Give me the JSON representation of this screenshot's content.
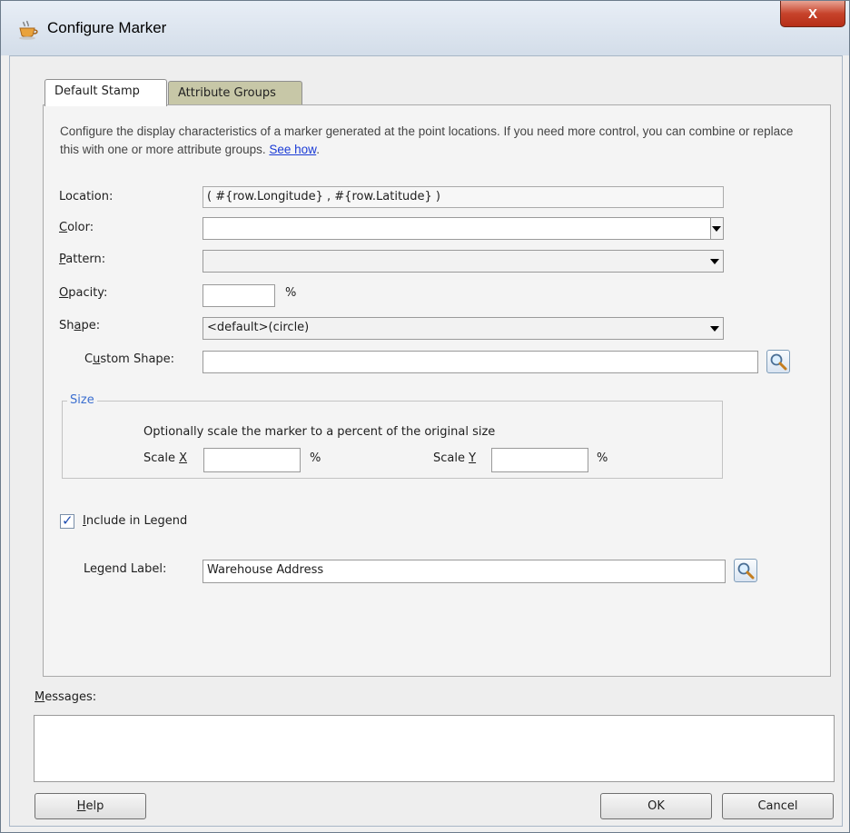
{
  "window": {
    "title": "Configure Marker",
    "close_label": "X"
  },
  "tabs": [
    {
      "label": "Default Stamp",
      "active": true
    },
    {
      "label": "Attribute Groups",
      "active": false
    }
  ],
  "description": {
    "text": "Configure the display characteristics of a marker generated at the point locations. If you need more control, you can combine or replace this with one or more attribute groups.",
    "link": "See how",
    "suffix": "."
  },
  "form": {
    "location": {
      "label": "Location:",
      "value": "( #{row.Longitude} , #{row.Latitude} )"
    },
    "color": {
      "label_mnemonic": "C",
      "label_rest": "olor:",
      "value": ""
    },
    "pattern": {
      "label_mnemonic": "P",
      "label_rest": "attern:",
      "value": ""
    },
    "opacity": {
      "label_mnemonic": "O",
      "label_rest": "pacity:",
      "value": "",
      "unit": "%"
    },
    "shape": {
      "label_pre": "Sh",
      "label_mnemonic": "a",
      "label_rest": "pe:",
      "value": "<default>(circle)"
    },
    "custom_shape": {
      "label_pre": "C",
      "label_mnemonic": "u",
      "label_rest": "stom Shape:",
      "value": ""
    }
  },
  "size": {
    "legend": "Size",
    "hint": "Optionally scale the marker to a percent of the original size",
    "scale_x": {
      "label_pre": "Scale ",
      "label_mnemonic": "X",
      "value": "",
      "unit": "%"
    },
    "scale_y": {
      "label_pre": "Scale ",
      "label_mnemonic": "Y",
      "value": "",
      "unit": "%"
    }
  },
  "legend": {
    "include": {
      "label_mnemonic": "I",
      "label_rest": "nclude in Legend",
      "checked": true
    },
    "label_field": {
      "label_pre": "Le",
      "label_mnemonic": "g",
      "label_rest": "end Label:",
      "value": "Warehouse Address"
    }
  },
  "messages": {
    "label_mnemonic": "M",
    "label_rest": "essages:"
  },
  "buttons": {
    "help_mnemonic": "H",
    "help_rest": "elp",
    "ok": "OK",
    "cancel": "Cancel"
  },
  "icons": {
    "title_icon": "coffee-cup-icon",
    "browse_icon": "magnifier-icon"
  }
}
